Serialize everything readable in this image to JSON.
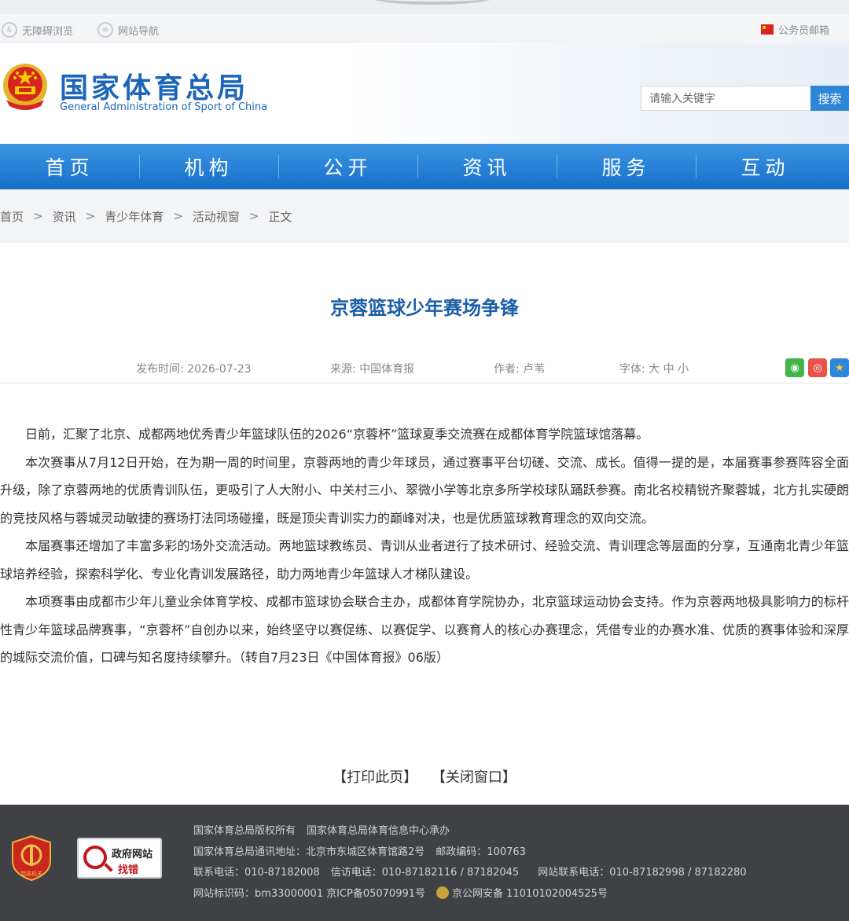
{
  "utility": {
    "accessible": "无障碍浏览",
    "site_nav": "网站导航",
    "staff_mail": "公务员邮箱"
  },
  "header": {
    "title_cn": "国家体育总局",
    "title_en": "General Administration of Sport of China",
    "search_placeholder": "请输入关键字",
    "search_button": "搜索"
  },
  "nav": {
    "items": [
      "首页",
      "机构",
      "公开",
      "资讯",
      "服务",
      "互动"
    ]
  },
  "breadcrumb": {
    "items": [
      "首页",
      "资讯",
      "青少年体育",
      "活动视窗",
      "正文"
    ],
    "separator": ">"
  },
  "article": {
    "title": "京蓉篮球少年赛场争锋",
    "publish_label": "发布时间:",
    "publish_date": "2026-07-23",
    "source_label": "来源:",
    "source": "中国体育报",
    "author_label": "作者:",
    "author": "卢苇",
    "font_label": "字体:",
    "font_large": "大",
    "font_medium": "中",
    "font_small": "小",
    "paragraphs": [
      "日前，汇聚了北京、成都两地优秀青少年篮球队伍的2026“京蓉杯”篮球夏季交流赛在成都体育学院篮球馆落幕。",
      "本次赛事从7月12日开始，在为期一周的时间里，京蓉两地的青少年球员，通过赛事平台切磋、交流、成长。值得一提的是，本届赛事参赛阵容全面升级，除了京蓉两地的优质青训队伍，更吸引了人大附小、中关村三小、翠微小学等北京多所学校球队踊跃参赛。南北名校精锐齐聚蓉城，北方扎实硬朗的竞技风格与蓉城灵动敏捷的赛场打法同场碰撞，既是顶尖青训实力的巅峰对决，也是优质篮球教育理念的双向交流。",
      "本届赛事还增加了丰富多彩的场外交流活动。两地篮球教练员、青训从业者进行了技术研讨、经验交流、青训理念等层面的分享，互通南北青少年篮球培养经验，探索科学化、专业化青训发展路径，助力两地青少年篮球人才梯队建设。",
      "本项赛事由成都市少年儿童业余体育学校、成都市篮球协会联合主办，成都体育学院协办，北京篮球运动协会支持。作为京蓉两地极具影响力的标杆性青少年篮球品牌赛事，“京蓉杯”自创办以来，始终坚守以赛促练、以赛促学、以赛育人的核心办赛理念，凭借专业的办赛水准、优质的赛事体验和深厚的城际交流价值，口碑与知名度持续攀升。（转自7月23日《中国体育报》06版）"
    ],
    "print": "【打印此页】",
    "close": "【关闭窗口】"
  },
  "footer": {
    "badge_text": "党政机关",
    "find_t1": "政府网站",
    "find_t2": "找错",
    "copyright": "国家体育总局版权所有",
    "undertaker": "国家体育总局体育信息中心承办",
    "address": "国家体育总局通讯地址：北京市东城区体育馆路2号",
    "postcode": "邮政编码：100763",
    "phone": "联系电话：010-87182008",
    "letters": "信访电话：010-87182116 / 87182045",
    "site_phone": "网站联系电话：010-87182998 / 87182280",
    "site_id": "网站标识码：bm33000001",
    "icp": "京ICP备05070991号",
    "police": "京公网安备 11010102004525号"
  },
  "colors": {
    "brand_blue": "#1d65b8",
    "nav_blue": "#1670c9",
    "title_blue": "#1d5fa7",
    "footer_bg": "#3f4144"
  }
}
